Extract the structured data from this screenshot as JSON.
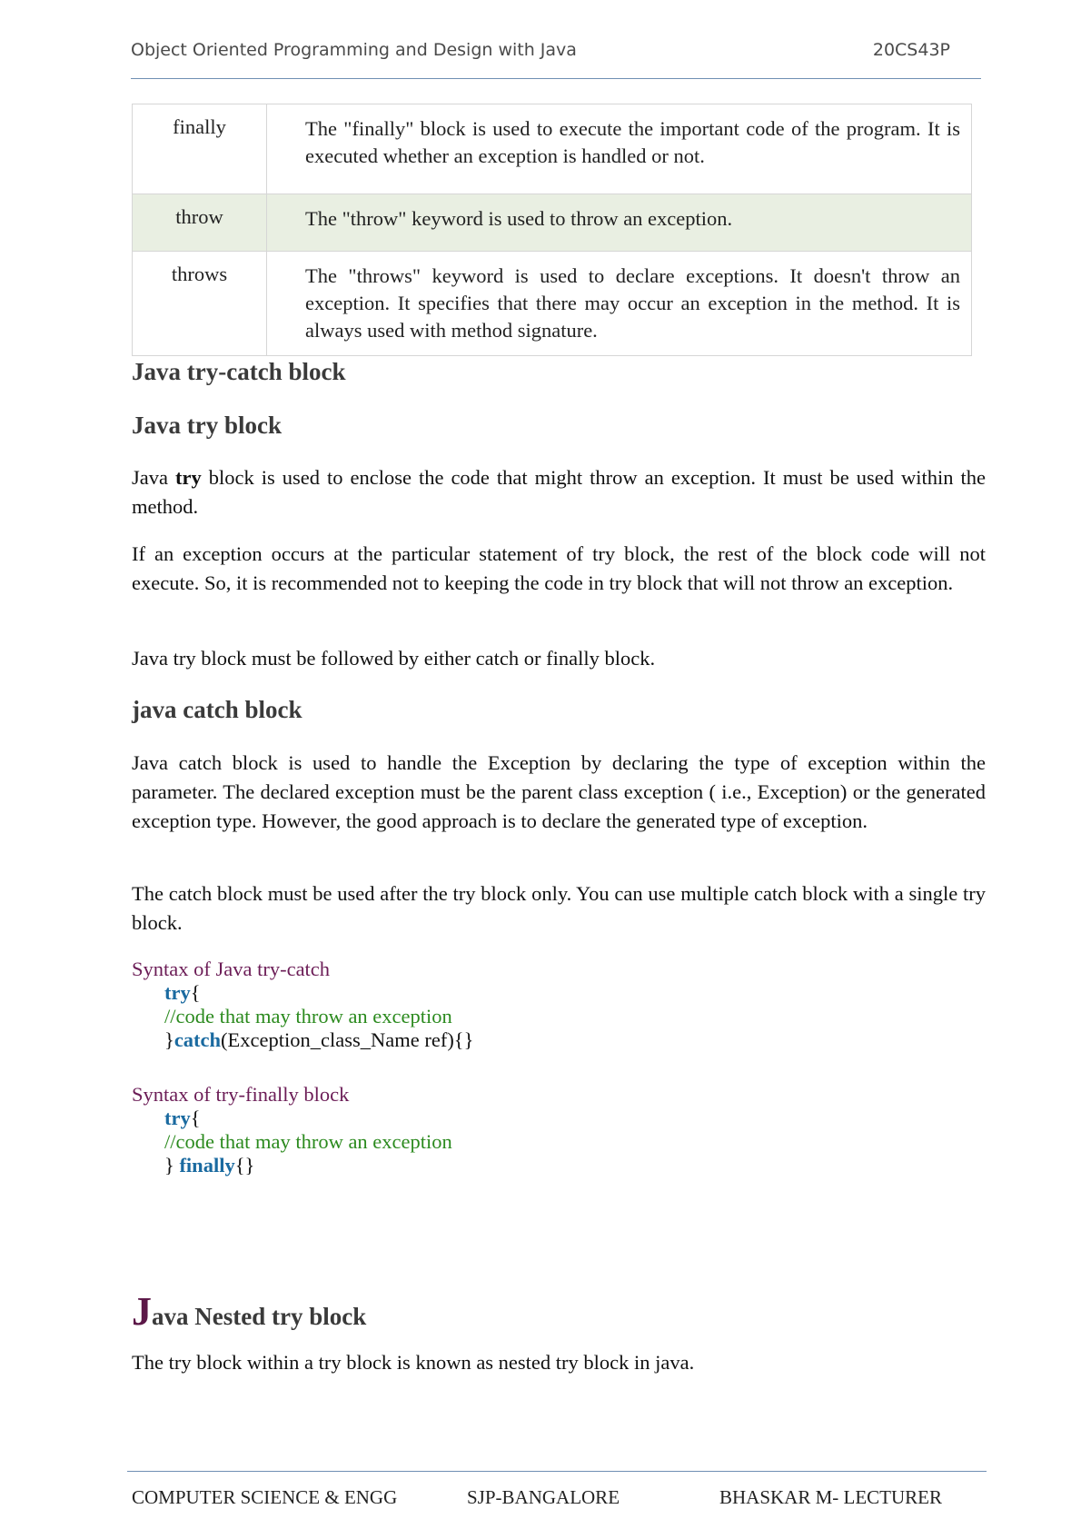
{
  "header": {
    "title": "Object Oriented Programming and Design with Java",
    "course_code": "20CS43P"
  },
  "keyword_table": {
    "rows": [
      {
        "keyword": "finally",
        "description": "The \"finally\" block is used to execute the important code of the program. It is executed whether an exception is handled or not."
      },
      {
        "keyword": "throw",
        "description": "The \"throw\" keyword is used to throw an exception."
      },
      {
        "keyword": "throws",
        "description": "The \"throws\" keyword is used to declare exceptions. It doesn't throw an exception. It specifies that there may occur an exception in the method. It is always used with method signature."
      }
    ]
  },
  "sections": {
    "try_catch_heading": "Java try-catch block",
    "try_block_heading": "Java try block",
    "try_para1_prefix": "Java ",
    "try_para1_bold": "try",
    "try_para1_suffix": " block is used to enclose the code that might throw an exception. It must be used within the method.",
    "try_para2": "If an exception occurs at the particular statement of try block, the rest of the block code will not execute. So, it is recommended not to keeping the code in try block that will not throw an exception.",
    "try_para3": "Java try block must be followed by either catch or finally block.",
    "catch_heading": "java catch block",
    "catch_para1": "Java catch block is used to handle the Exception by declaring the type of exception within the parameter. The declared exception must be the parent class exception ( i.e., Exception) or the generated exception type. However, the good approach is to declare the generated type of exception.",
    "catch_para2": "The catch block must be used after the try block only. You can use multiple catch block with a single try block.",
    "nested_heading_initial": "J",
    "nested_heading_rest": "ava Nested try block",
    "nested_para": "The try block within a try block is known as nested try block in java."
  },
  "syntax_try_catch": {
    "title": "Syntax of Java try-catch",
    "kw_try": "try",
    "open_brace": "{",
    "comment": "//code that may throw an exception",
    "close_brace": "}",
    "kw_catch": "catch",
    "catch_rest": "(Exception_class_Name ref){}"
  },
  "syntax_try_finally": {
    "title": "Syntax of try-finally block",
    "kw_try": "try",
    "open_brace": "{",
    "comment": "//code that may throw an exception",
    "close_brace": "} ",
    "kw_finally": "finally",
    "finally_rest": "{}"
  },
  "footer": {
    "dept": "COMPUTER SCIENCE & ENGG",
    "college": "SJP-BANGALORE",
    "author": "BHASKAR M- LECTURER"
  }
}
